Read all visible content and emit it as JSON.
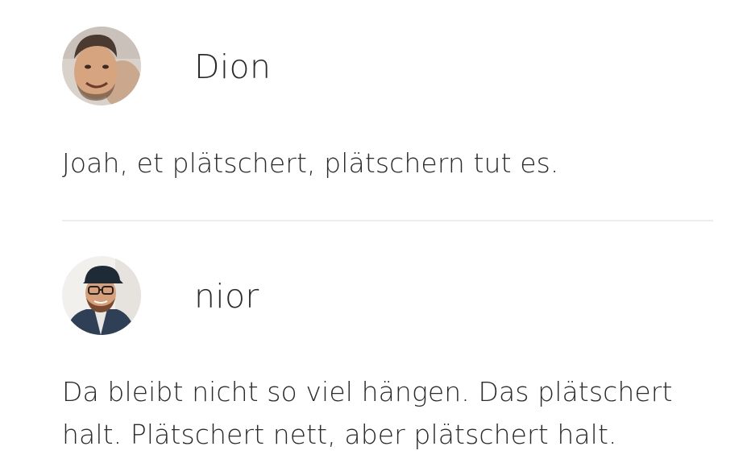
{
  "comments": [
    {
      "author": "Dion",
      "avatar_icon": "avatar-photo-icon",
      "text": "Joah, et plätschert, plätschern tut es."
    },
    {
      "author": "nior",
      "avatar_icon": "avatar-photo-icon",
      "text": "Da bleibt nicht so viel hängen. Das plätschert halt. Plätschert nett, aber plätschert halt."
    }
  ]
}
